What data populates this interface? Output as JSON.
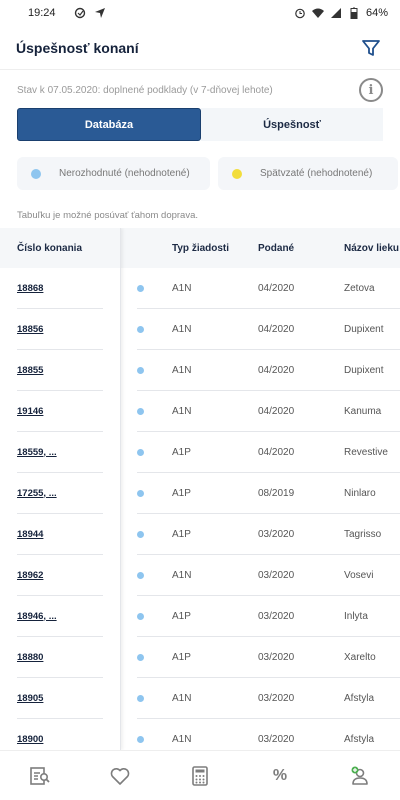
{
  "status_bar": {
    "time": "19:24",
    "battery": "64%"
  },
  "appbar": {
    "title": "Úspešnosť konaní",
    "filter_icon": "filter-icon"
  },
  "info": {
    "text": "Stav k 07.05.2020: doplnené podklady (v 7-dňovej lehote)",
    "info_icon": "i"
  },
  "tabs": [
    {
      "label": "Databáza",
      "active": true
    },
    {
      "label": "Úspešnosť",
      "active": false
    }
  ],
  "legend": [
    {
      "label": "Nerozhodnuté (nehodnotené)",
      "color": "#8ec5ef"
    },
    {
      "label": "Spätvzaté (nehodnotené)",
      "color": "#f2dd3b"
    }
  ],
  "scroll_hint": "Tabuľku je možné posúvať ťahom doprava.",
  "table": {
    "headers": {
      "id": "Číslo konania",
      "type": "Typ žiadosti",
      "date": "Podané",
      "name": "Názov lieku"
    },
    "rows": [
      {
        "id": "18868",
        "type": "A1N",
        "date": "04/2020",
        "name": "Zetova"
      },
      {
        "id": "18856",
        "type": "A1N",
        "date": "04/2020",
        "name": "Dupixent"
      },
      {
        "id": "18855",
        "type": "A1N",
        "date": "04/2020",
        "name": "Dupixent"
      },
      {
        "id": "19146",
        "type": "A1N",
        "date": "04/2020",
        "name": "Kanuma"
      },
      {
        "id": "18559, ...",
        "type": "A1P",
        "date": "04/2020",
        "name": "Revestive"
      },
      {
        "id": "17255, ...",
        "type": "A1P",
        "date": "08/2019",
        "name": "Ninlaro"
      },
      {
        "id": "18944",
        "type": "A1P",
        "date": "03/2020",
        "name": "Tagrisso"
      },
      {
        "id": "18962",
        "type": "A1N",
        "date": "03/2020",
        "name": "Vosevi"
      },
      {
        "id": "18946, ...",
        "type": "A1P",
        "date": "03/2020",
        "name": "Inlyta"
      },
      {
        "id": "18880",
        "type": "A1P",
        "date": "03/2020",
        "name": "Xarelto"
      },
      {
        "id": "18905",
        "type": "A1N",
        "date": "03/2020",
        "name": "Afstyla"
      },
      {
        "id": "18900",
        "type": "A1N",
        "date": "03/2020",
        "name": "Afstyla"
      }
    ]
  },
  "bottom_nav": {
    "percent_label": "%"
  }
}
